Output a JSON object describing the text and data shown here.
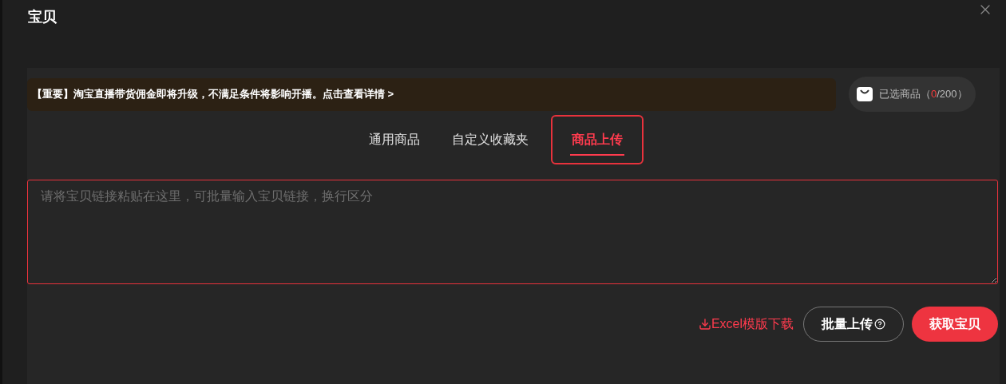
{
  "window": {
    "title": "宝贝"
  },
  "notice": {
    "text": "【重要】淘宝直播带货佣金即将升级，不满足条件将影响开播。点击查看详情 >"
  },
  "selected_chip": {
    "label": "已选商品",
    "prefix": "（",
    "count": "0",
    "suffix": "/200）"
  },
  "tabs": [
    {
      "label": "通用商品",
      "selected": false
    },
    {
      "label": "自定义收藏夹",
      "selected": false
    },
    {
      "label": "商品上传",
      "selected": true
    }
  ],
  "link_input": {
    "placeholder": "请将宝贝链接粘贴在这里，可批量输入宝贝链接，换行区分"
  },
  "actions": {
    "download_link": "Excel模版下载",
    "batch_upload": "批量上传",
    "fetch": "获取宝贝"
  }
}
